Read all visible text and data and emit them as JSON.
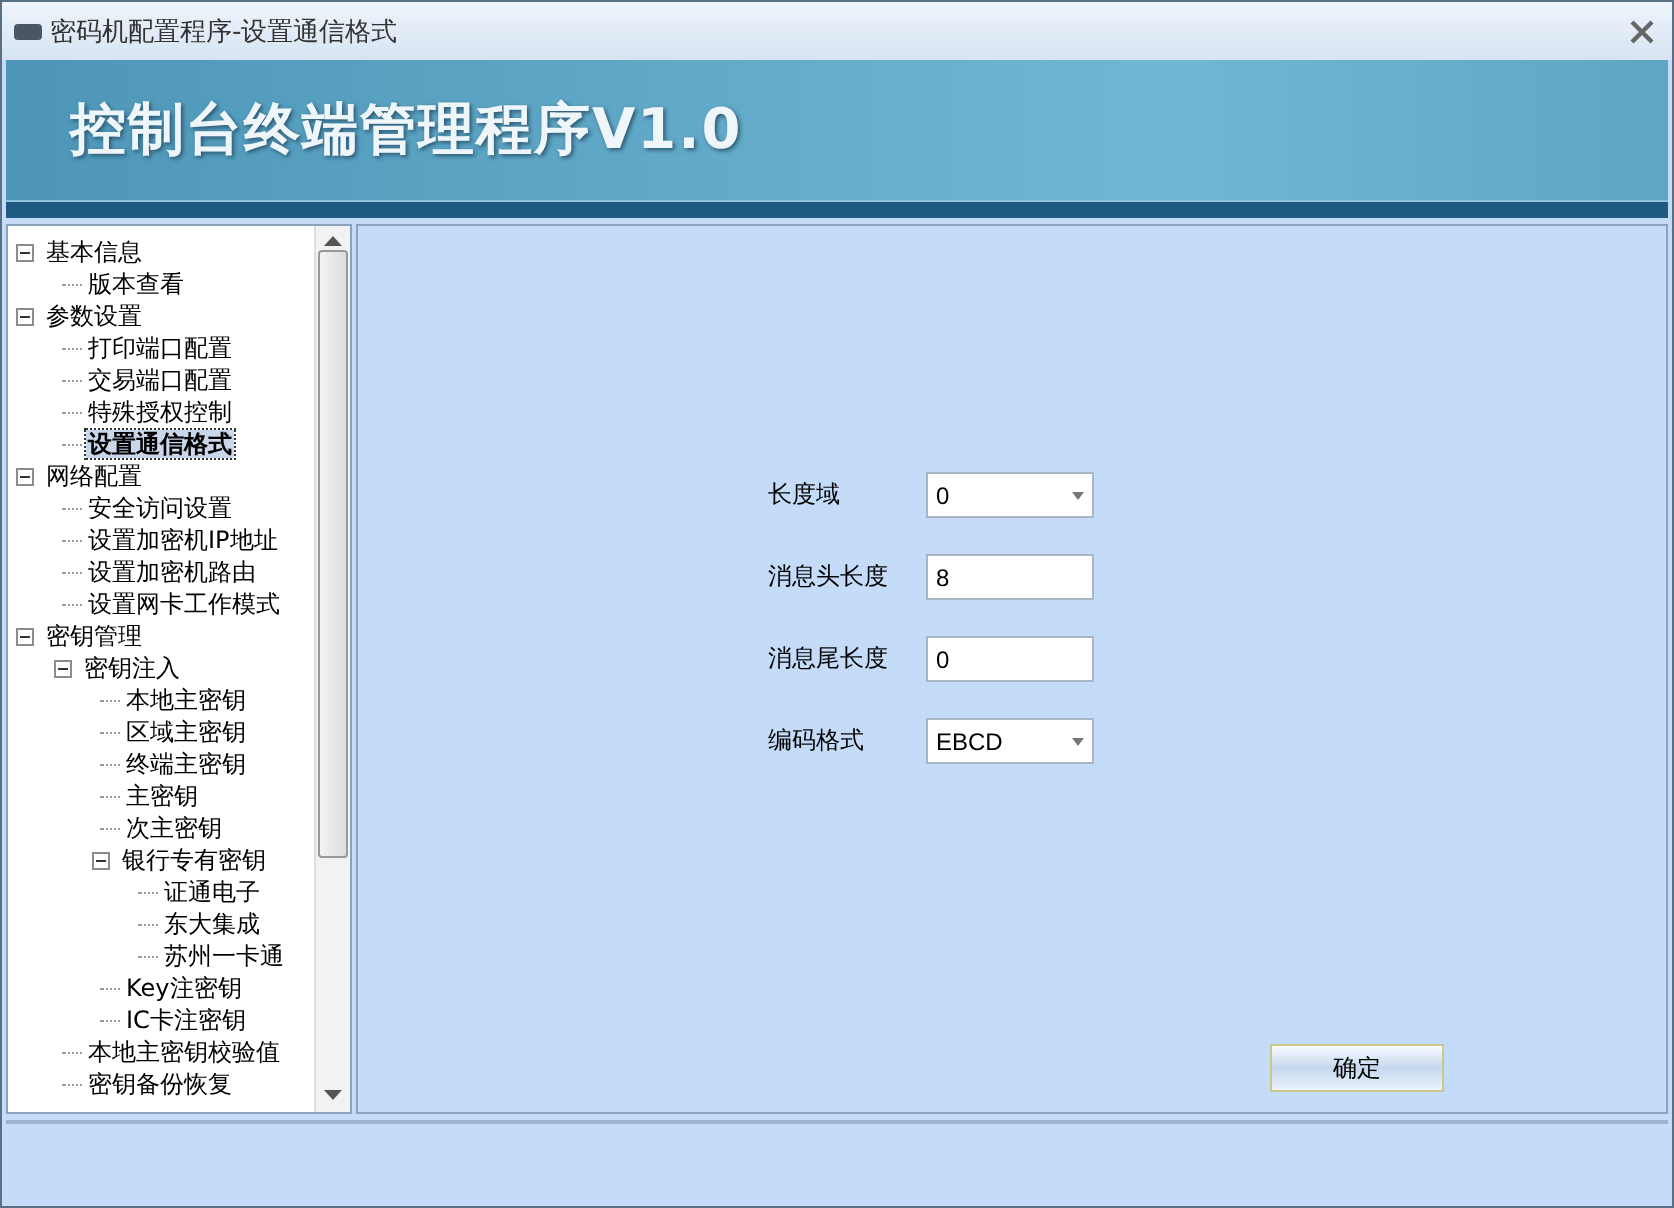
{
  "window": {
    "title": "密码机配置程序-设置通信格式"
  },
  "banner": {
    "title": "控制台终端管理程序V1.0"
  },
  "tree": [
    {
      "label": "基本信息",
      "expanded": true,
      "selected": false,
      "children": [
        {
          "label": "版本查看",
          "selected": false
        }
      ]
    },
    {
      "label": "参数设置",
      "expanded": true,
      "selected": false,
      "children": [
        {
          "label": "打印端口配置",
          "selected": false
        },
        {
          "label": "交易端口配置",
          "selected": false
        },
        {
          "label": "特殊授权控制",
          "selected": false
        },
        {
          "label": "设置通信格式",
          "selected": true
        }
      ]
    },
    {
      "label": "网络配置",
      "expanded": true,
      "selected": false,
      "children": [
        {
          "label": "安全访问设置",
          "selected": false
        },
        {
          "label": "设置加密机IP地址",
          "selected": false
        },
        {
          "label": "设置加密机路由",
          "selected": false
        },
        {
          "label": "设置网卡工作模式",
          "selected": false
        }
      ]
    },
    {
      "label": "密钥管理",
      "expanded": true,
      "selected": false,
      "children": [
        {
          "label": "密钥注入",
          "expanded": true,
          "selected": false,
          "children": [
            {
              "label": "本地主密钥",
              "selected": false
            },
            {
              "label": "区域主密钥",
              "selected": false
            },
            {
              "label": "终端主密钥",
              "selected": false
            },
            {
              "label": "主密钥",
              "selected": false
            },
            {
              "label": "次主密钥",
              "selected": false
            },
            {
              "label": "银行专有密钥",
              "expanded": true,
              "selected": false,
              "children": [
                {
                  "label": "证通电子",
                  "selected": false
                },
                {
                  "label": "东大集成",
                  "selected": false
                },
                {
                  "label": "苏州一卡通",
                  "selected": false
                }
              ]
            },
            {
              "label": "Key注密钥",
              "selected": false
            },
            {
              "label": "IC卡注密钥",
              "selected": false
            }
          ]
        },
        {
          "label": "本地主密钥校验值",
          "selected": false
        },
        {
          "label": "密钥备份恢复",
          "selected": false
        }
      ]
    }
  ],
  "form": {
    "fields": [
      {
        "label": "长度域",
        "kind": "dropdown",
        "value": "0"
      },
      {
        "label": "消息头长度",
        "kind": "text",
        "value": "8"
      },
      {
        "label": "消息尾长度",
        "kind": "text",
        "value": "0"
      },
      {
        "label": "编码格式",
        "kind": "dropdown",
        "value": "EBCD"
      }
    ],
    "button": "确定"
  }
}
